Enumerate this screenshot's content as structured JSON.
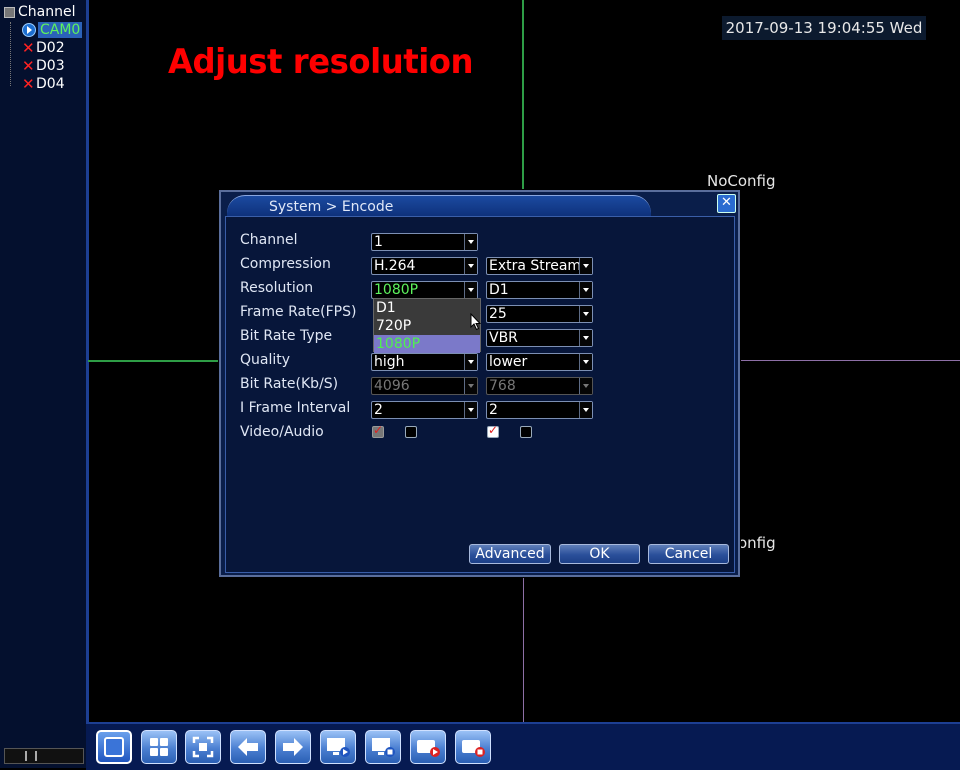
{
  "sidebar": {
    "root_label": "Channel",
    "items": [
      {
        "label": "CAM0",
        "status": "online"
      },
      {
        "label": "D02",
        "status": "offline"
      },
      {
        "label": "D03",
        "status": "offline"
      },
      {
        "label": "D04",
        "status": "offline"
      }
    ]
  },
  "overlay": {
    "title": "Adjust resolution",
    "datetime": "2017-09-13 19:04:55 Wed",
    "noconfig_top": "NoConfig",
    "noconfig_bottom": "onfig"
  },
  "dialog": {
    "title": "System > Encode",
    "close_icon": "close-icon",
    "labels": {
      "channel": "Channel",
      "compression": "Compression",
      "resolution": "Resolution",
      "frame_rate": "Frame Rate(FPS)",
      "bit_rate_type": "Bit Rate Type",
      "quality": "Quality",
      "bit_rate": "Bit Rate(Kb/S)",
      "iframe": "I Frame Interval",
      "video_audio": "Video/Audio"
    },
    "main_stream": {
      "channel": "1",
      "compression": "H.264",
      "resolution": "1080P",
      "quality": "high",
      "bit_rate": "4096",
      "iframe": "2",
      "video_checked": true,
      "audio_checked": false
    },
    "extra_stream": {
      "stream": "Extra Stream",
      "resolution": "D1",
      "frame_rate": "25",
      "bit_rate_type": "VBR",
      "quality": "lower",
      "bit_rate": "768",
      "iframe": "2",
      "video_checked": true,
      "audio_checked": false
    },
    "resolution_options": [
      "D1",
      "720P",
      "1080P"
    ],
    "resolution_selected": "1080P",
    "buttons": {
      "advanced": "Advanced",
      "ok": "OK",
      "cancel": "Cancel"
    }
  },
  "toolbar": {
    "icons": [
      "single-view-icon",
      "quad-view-icon",
      "fullscreen-icon",
      "previous-icon",
      "next-icon",
      "preview-play-icon",
      "preview-stop-icon",
      "record-play-icon",
      "record-stop-icon"
    ]
  },
  "colors": {
    "accent": "#2b62b9",
    "title_red": "#ff0000",
    "selected_green": "#5df25d",
    "panel": "#04102e"
  }
}
